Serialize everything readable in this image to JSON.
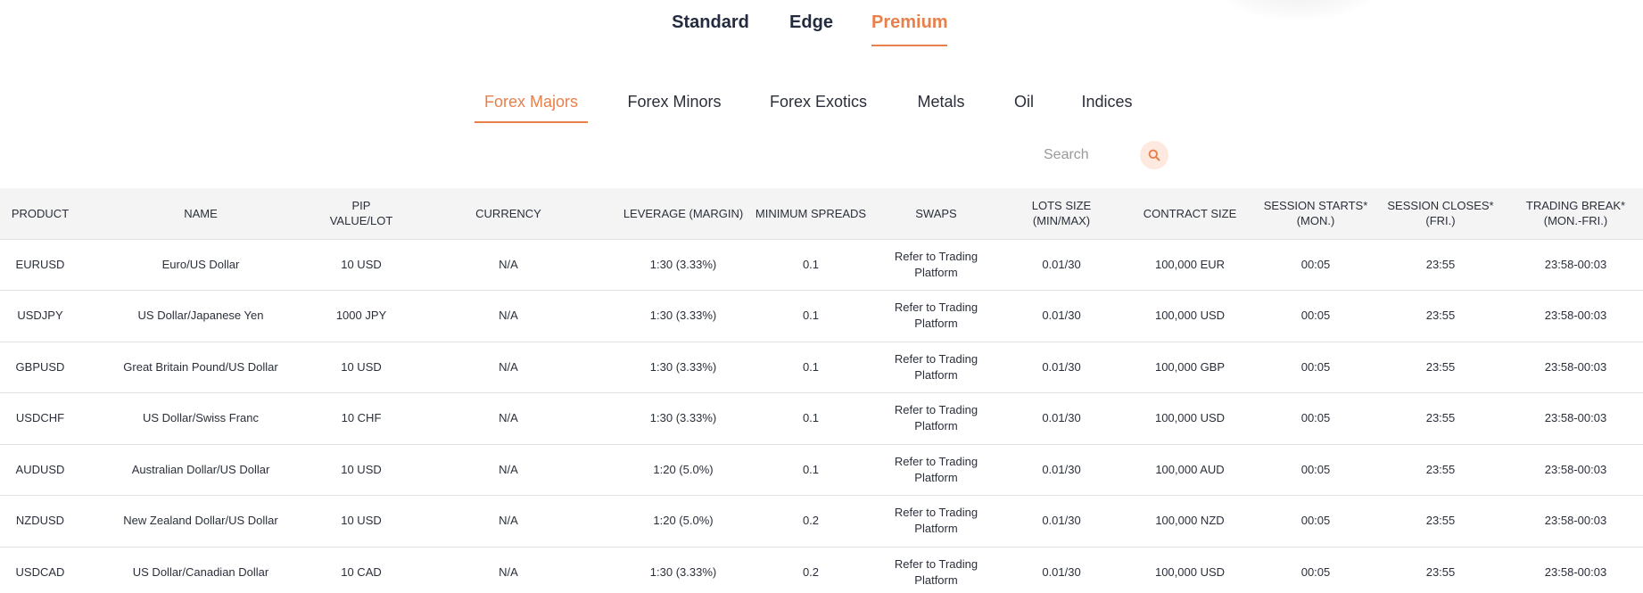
{
  "account_tabs": [
    {
      "label": "Standard",
      "active": false
    },
    {
      "label": "Edge",
      "active": false
    },
    {
      "label": "Premium",
      "active": true
    }
  ],
  "category_tabs": [
    {
      "label": "Forex Majors",
      "active": true
    },
    {
      "label": "Forex Minors",
      "active": false
    },
    {
      "label": "Forex Exotics",
      "active": false
    },
    {
      "label": "Metals",
      "active": false
    },
    {
      "label": "Oil",
      "active": false
    },
    {
      "label": "Indices",
      "active": false
    }
  ],
  "search": {
    "placeholder": "Search",
    "value": "",
    "icon": "search-icon"
  },
  "colors": {
    "accent": "#e8804c",
    "header_bg": "#f4f4f4",
    "text": "#2a2f3a"
  },
  "table": {
    "columns": [
      "PRODUCT",
      "NAME",
      "PIP VALUE/LOT",
      "CURRENCY",
      "LEVERAGE (MARGIN)",
      "MINIMUM SPREADS",
      "SWAPS",
      "LOTS SIZE (MIN/MAX)",
      "CONTRACT SIZE",
      "SESSION STARTS* (MON.)",
      "SESSION CLOSES* (FRI.)",
      "TRADING BREAK* (MON.-FRI.)"
    ],
    "rows": [
      [
        "EURUSD",
        "Euro/US Dollar",
        "10 USD",
        "N/A",
        "1:30 (3.33%)",
        "0.1",
        "Refer to Trading Platform",
        "0.01/30",
        "100,000 EUR",
        "00:05",
        "23:55",
        "23:58-00:03"
      ],
      [
        "USDJPY",
        "US Dollar/Japanese Yen",
        "1000 JPY",
        "N/A",
        "1:30 (3.33%)",
        "0.1",
        "Refer to Trading Platform",
        "0.01/30",
        "100,000 USD",
        "00:05",
        "23:55",
        "23:58-00:03"
      ],
      [
        "GBPUSD",
        "Great Britain Pound/US Dollar",
        "10 USD",
        "N/A",
        "1:30 (3.33%)",
        "0.1",
        "Refer to Trading Platform",
        "0.01/30",
        "100,000 GBP",
        "00:05",
        "23:55",
        "23:58-00:03"
      ],
      [
        "USDCHF",
        "US Dollar/Swiss Franc",
        "10 CHF",
        "N/A",
        "1:30 (3.33%)",
        "0.1",
        "Refer to Trading Platform",
        "0.01/30",
        "100,000 USD",
        "00:05",
        "23:55",
        "23:58-00:03"
      ],
      [
        "AUDUSD",
        "Australian Dollar/US Dollar",
        "10 USD",
        "N/A",
        "1:20 (5.0%)",
        "0.1",
        "Refer to Trading Platform",
        "0.01/30",
        "100,000 AUD",
        "00:05",
        "23:55",
        "23:58-00:03"
      ],
      [
        "NZDUSD",
        "New Zealand Dollar/US Dollar",
        "10 USD",
        "N/A",
        "1:20 (5.0%)",
        "0.2",
        "Refer to Trading Platform",
        "0.01/30",
        "100,000 NZD",
        "00:05",
        "23:55",
        "23:58-00:03"
      ],
      [
        "USDCAD",
        "US Dollar/Canadian Dollar",
        "10 CAD",
        "N/A",
        "1:30 (3.33%)",
        "0.2",
        "Refer to Trading Platform",
        "0.01/30",
        "100,000 USD",
        "00:05",
        "23:55",
        "23:58-00:03"
      ]
    ]
  }
}
